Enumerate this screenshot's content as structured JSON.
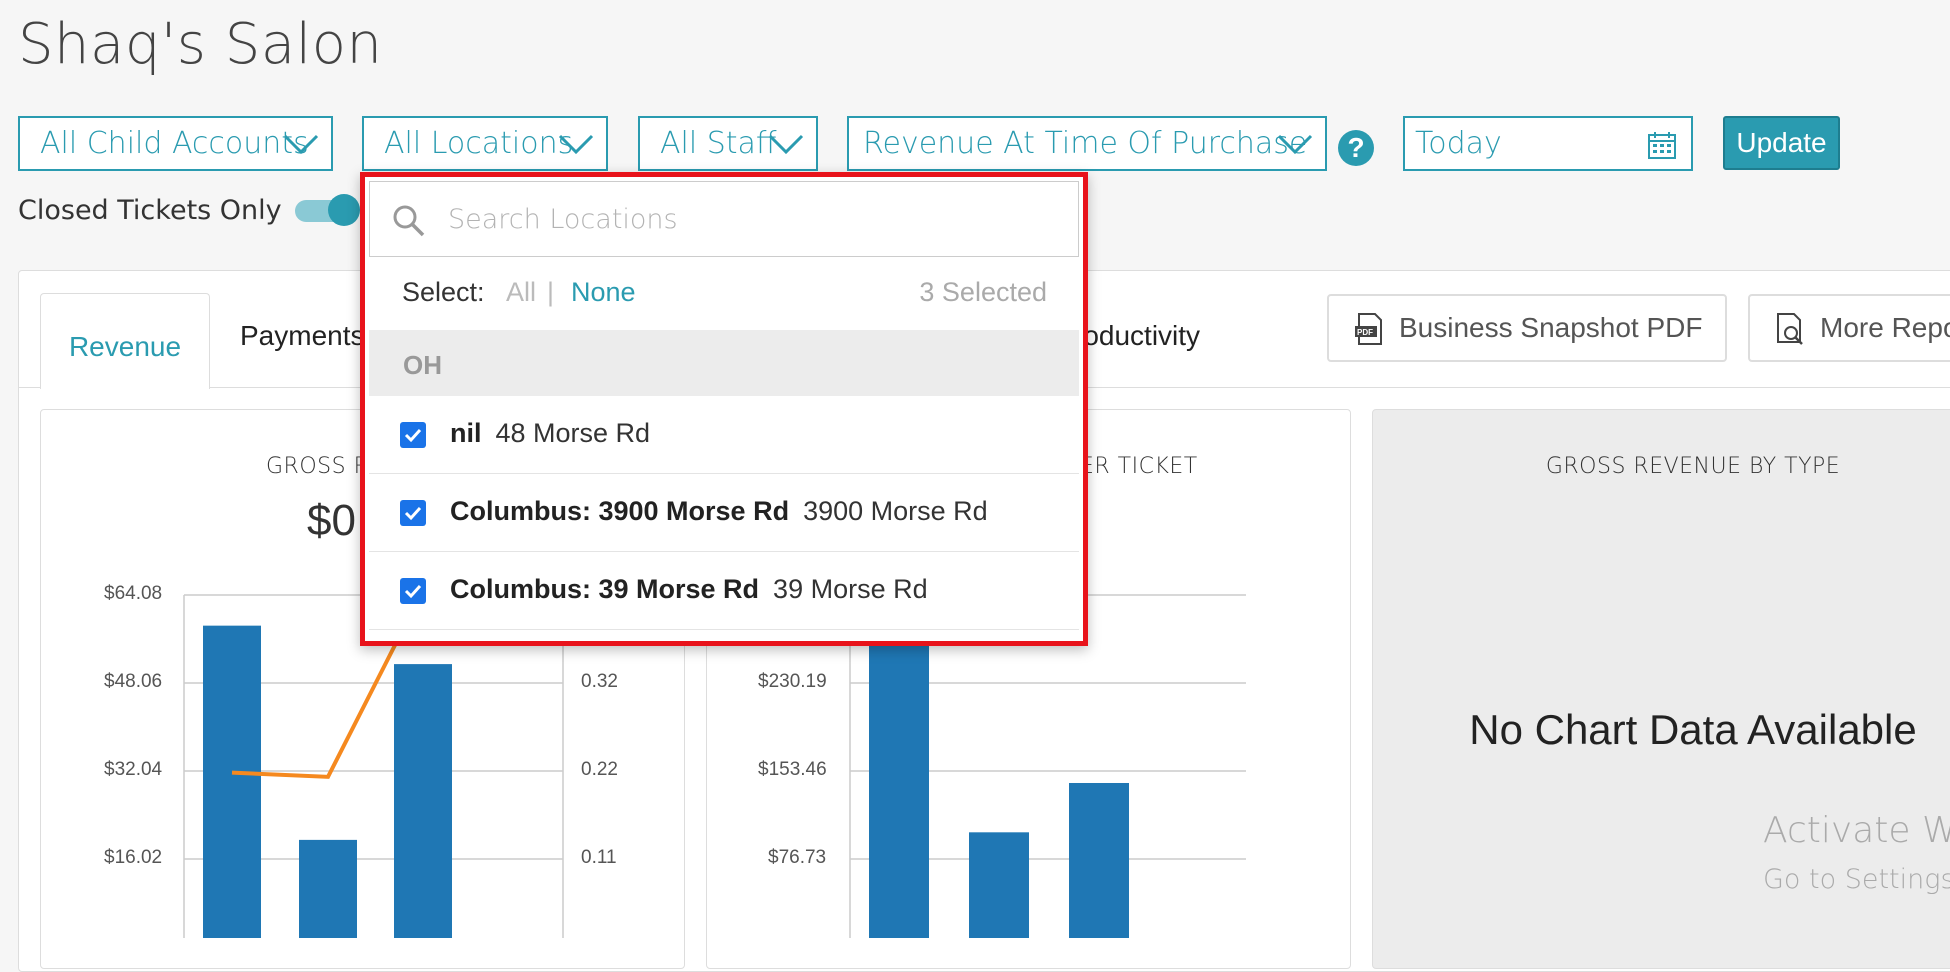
{
  "header": {
    "title": "Shaq's Salon"
  },
  "filters": {
    "child_accounts": "All Child Accounts",
    "locations": "All Locations",
    "staff": "All Staff",
    "revenue_type": "Revenue At Time Of Purchase",
    "help": "?",
    "date": "Today",
    "update": "Update"
  },
  "toggle": {
    "label": "Closed Tickets Only",
    "on": true
  },
  "tabs": [
    {
      "label": "Revenue",
      "active": true
    },
    {
      "label": "Payments"
    },
    {
      "label": "roductivity"
    }
  ],
  "tools": {
    "snapshot_pdf": "Business Snapshot PDF",
    "more_reports": "More Repo"
  },
  "cards": {
    "gross_revenue": {
      "title": "GROSS R",
      "value": "$0",
      "left_ticks": [
        "$64.08",
        "$48.06",
        "$32.04",
        "$16.02"
      ],
      "right_ticks": [
        "0.32",
        "0.22",
        "0.11"
      ]
    },
    "per_ticket": {
      "title": "ER TICKET",
      "left_ticks": [
        "$230.19",
        "$153.46",
        "$76.73"
      ]
    },
    "revenue_by_type": {
      "title": "GROSS REVENUE BY TYPE",
      "no_data": "No Chart Data Available"
    }
  },
  "chart_data": [
    {
      "type": "bar",
      "title": "GROSS R",
      "categories": [
        "",
        "",
        ""
      ],
      "series": [
        {
          "values": [
            58.5,
            19.5,
            51.5
          ]
        },
        {
          "type": "line",
          "values": [
            0.21,
            0.205,
            0.43
          ]
        }
      ],
      "ylim": [
        0,
        64.08
      ],
      "y2lim": [
        0,
        0.43
      ]
    },
    {
      "type": "bar",
      "title": "ER TICKET",
      "categories": [
        "",
        "",
        ""
      ],
      "values": [
        307,
        100,
        143
      ],
      "ylim": [
        0,
        306.92
      ]
    }
  ],
  "dropdown": {
    "search_placeholder": "Search Locations",
    "select_label": "Select:",
    "all": "All",
    "separator": "|",
    "none": "None",
    "count": "3 Selected",
    "group": "OH",
    "items": [
      {
        "name": "nil",
        "address": "48 Morse Rd",
        "checked": true
      },
      {
        "name": "Columbus: 3900 Morse Rd",
        "address": "3900 Morse Rd",
        "checked": true
      },
      {
        "name": "Columbus: 39 Morse Rd",
        "address": "39 Morse Rd",
        "checked": true
      }
    ]
  },
  "watermark": {
    "line1": "Activate W",
    "line2": "Go to Settings"
  }
}
